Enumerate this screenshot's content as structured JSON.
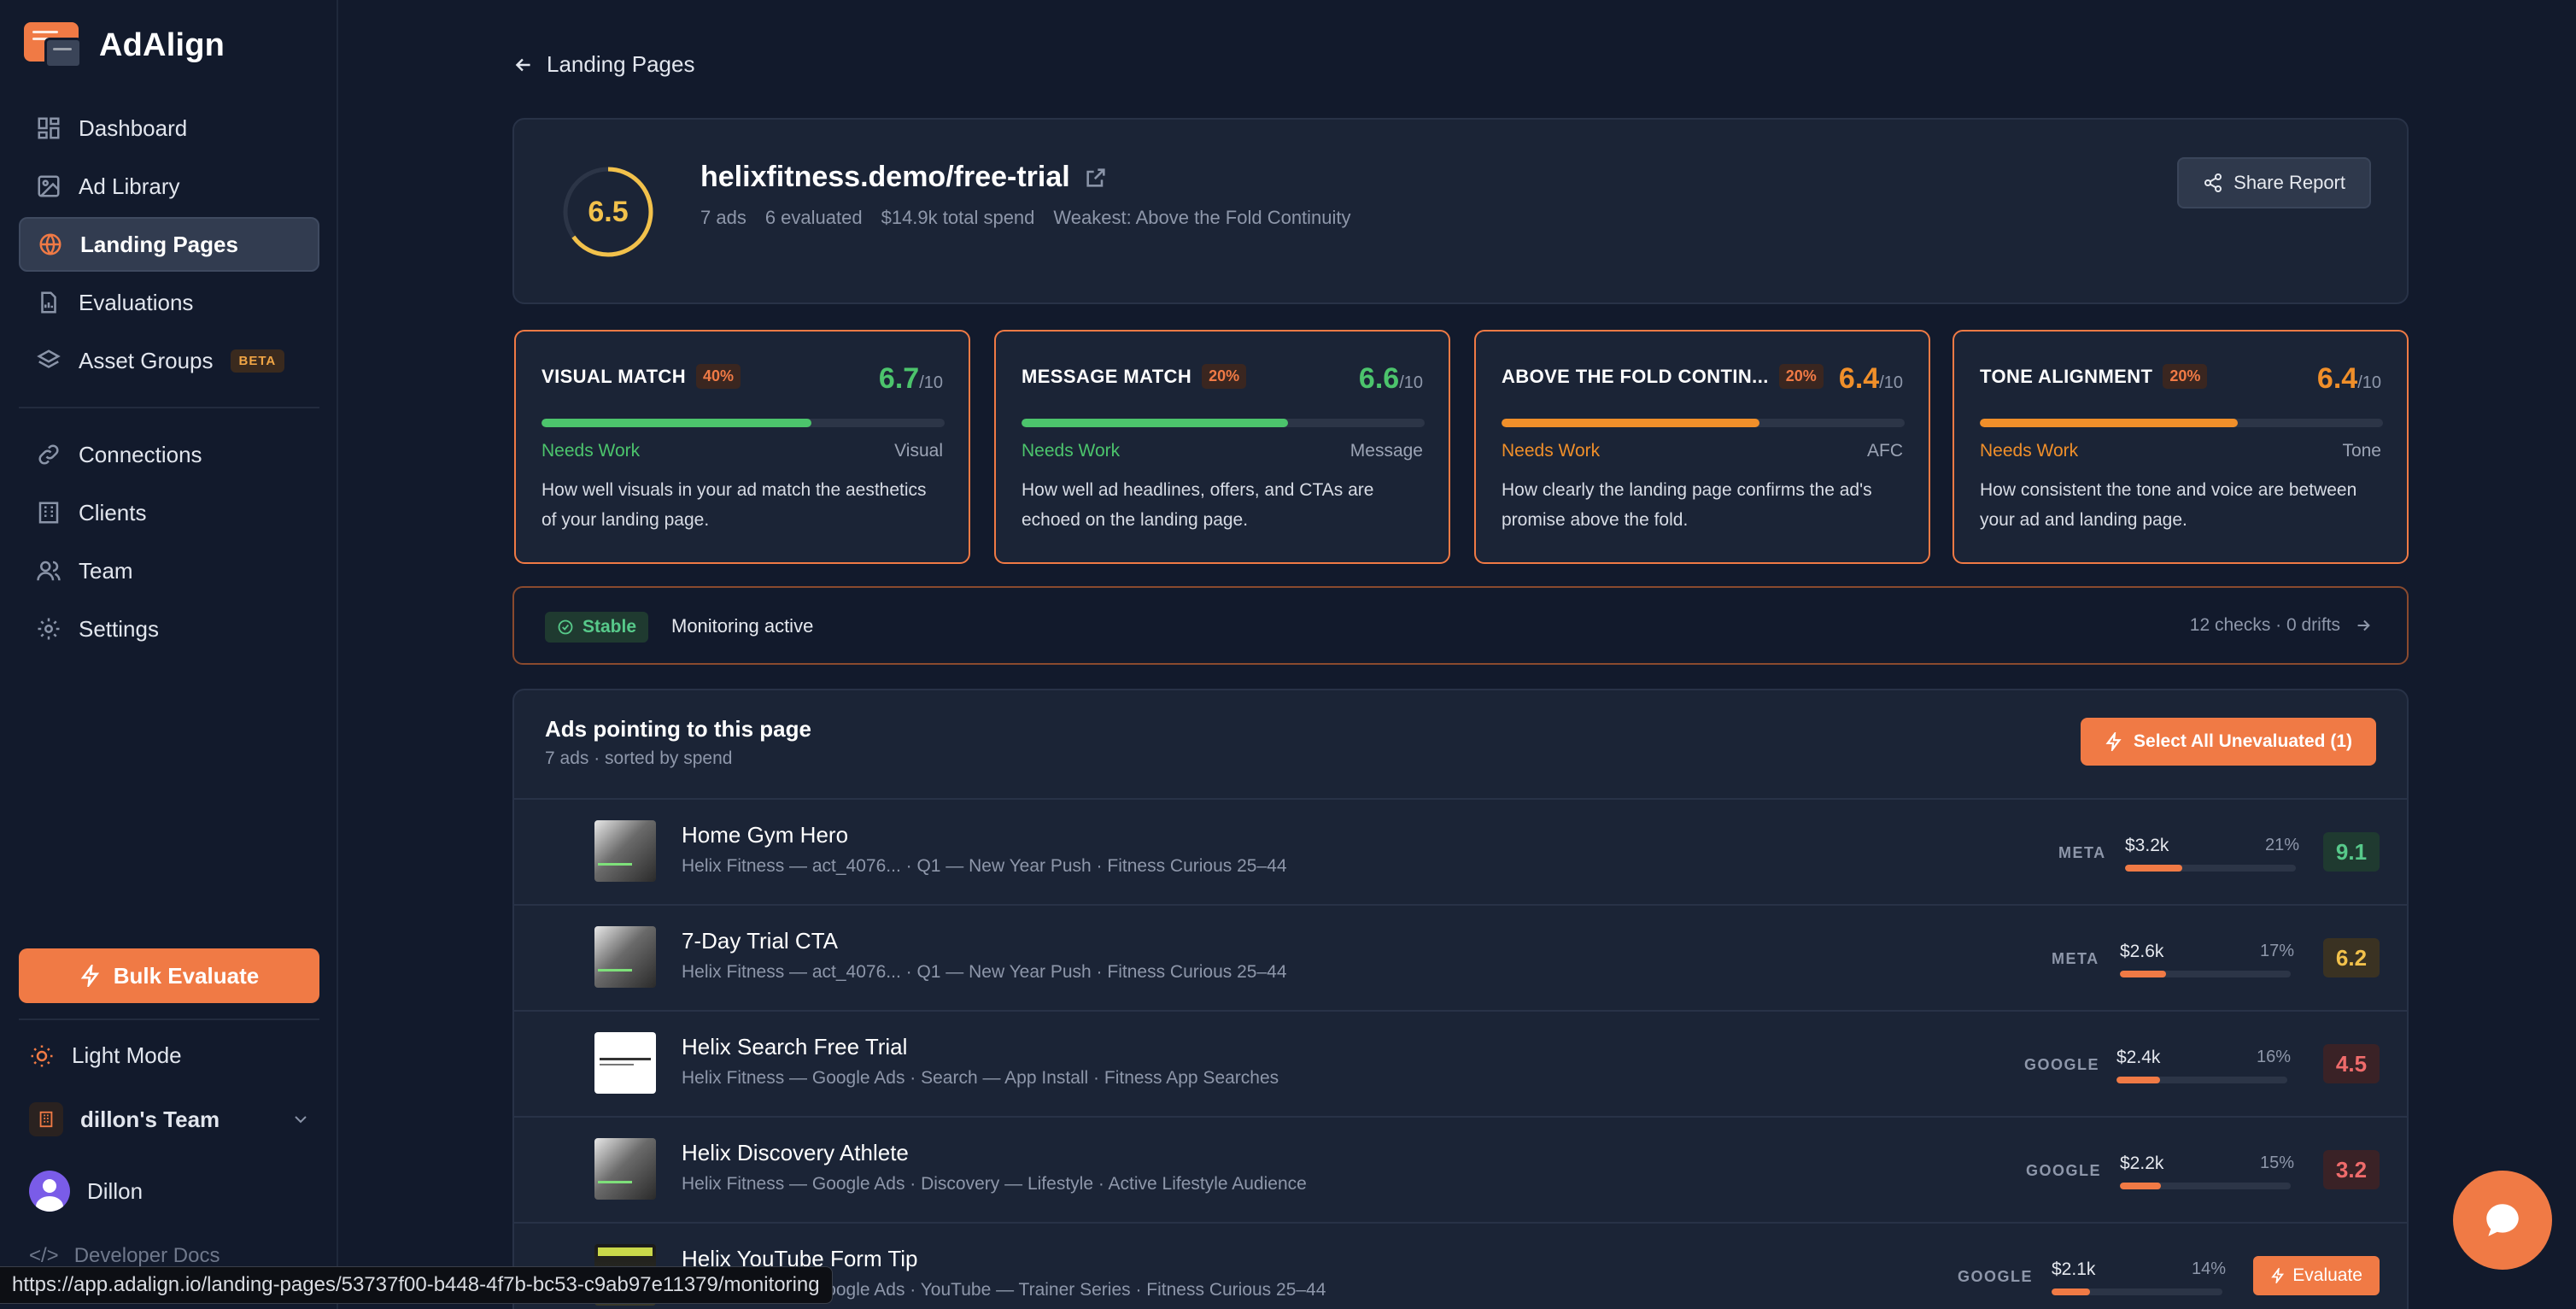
{
  "app": {
    "name": "AdAlign"
  },
  "sidebar": {
    "items": [
      {
        "label": "Dashboard",
        "icon": "grid-icon"
      },
      {
        "label": "Ad Library",
        "icon": "image-icon"
      },
      {
        "label": "Landing Pages",
        "icon": "globe-icon",
        "active": true
      },
      {
        "label": "Evaluations",
        "icon": "clipboard-icon"
      },
      {
        "label": "Asset Groups",
        "icon": "layers-icon",
        "badge": "BETA"
      },
      {
        "label": "Connections",
        "icon": "link-icon"
      },
      {
        "label": "Clients",
        "icon": "building-icon"
      },
      {
        "label": "Team",
        "icon": "users-icon"
      },
      {
        "label": "Settings",
        "icon": "gear-icon"
      }
    ],
    "bulk_evaluate": "Bulk Evaluate",
    "light_mode": "Light Mode",
    "team_name": "dillon's Team",
    "user_name": "Dillon",
    "developer_docs": "Developer Docs"
  },
  "breadcrumb": {
    "back_label": "Landing Pages"
  },
  "page": {
    "url": "helixfitness.demo/free-trial",
    "score": "6.5",
    "meta": [
      "7 ads",
      "6 evaluated",
      "$14.9k total spend",
      "Weakest: Above the Fold Continuity"
    ],
    "share_label": "Share Report"
  },
  "metrics": [
    {
      "name": "VISUAL MATCH",
      "weight": "40%",
      "score": "6.7",
      "out_of": "/10",
      "fill": 0.67,
      "status": "Needs Work",
      "tag": "Visual",
      "desc": "How well visuals in your ad match the aesthetics of your landing page.",
      "color": "#4cc46c"
    },
    {
      "name": "MESSAGE MATCH",
      "weight": "20%",
      "score": "6.6",
      "out_of": "/10",
      "fill": 0.66,
      "status": "Needs Work",
      "tag": "Message",
      "desc": "How well ad headlines, offers, and CTAs are echoed on the landing page.",
      "color": "#4cc46c"
    },
    {
      "name": "ABOVE THE FOLD CONTIN...",
      "weight": "20%",
      "score": "6.4",
      "out_of": "/10",
      "fill": 0.64,
      "status": "Needs Work",
      "tag": "AFC",
      "desc": "How clearly the landing page confirms the ad's promise above the fold.",
      "color": "#f08f2a"
    },
    {
      "name": "TONE ALIGNMENT",
      "weight": "20%",
      "score": "6.4",
      "out_of": "/10",
      "fill": 0.64,
      "status": "Needs Work",
      "tag": "Tone",
      "desc": "How consistent the tone and voice are between your ad and landing page.",
      "color": "#f08f2a"
    }
  ],
  "monitoring": {
    "badge": "Stable",
    "text": "Monitoring active",
    "summary": "12 checks · 0 drifts"
  },
  "ads_section": {
    "title": "Ads pointing to this page",
    "subtitle": "7 ads · sorted by spend",
    "select_label": "Select All Unevaluated (1)",
    "rows": [
      {
        "name": "Home Gym Hero",
        "sub": "Helix Fitness — act_4076... · Q1 — New Year Push · Fitness Curious 25–44",
        "platform": "META",
        "spend": "$3.2k",
        "pct": "21%",
        "share": 0.21,
        "score": "9.1",
        "score_color": "#57c98a",
        "score_bg": "#1f3a30",
        "thumb": "dark"
      },
      {
        "name": "7-Day Trial CTA",
        "sub": "Helix Fitness — act_4076... · Q1 — New Year Push · Fitness Curious 25–44",
        "platform": "META",
        "spend": "$2.6k",
        "pct": "17%",
        "share": 0.17,
        "score": "6.2",
        "score_color": "#f2c14b",
        "score_bg": "#3a3222",
        "thumb": "dark"
      },
      {
        "name": "Helix Search Free Trial",
        "sub": "Helix Fitness — Google Ads · Search — App Install · Fitness App Searches",
        "platform": "GOOGLE",
        "spend": "$2.4k",
        "pct": "16%",
        "share": 0.16,
        "score": "4.5",
        "score_color": "#ef6b6b",
        "score_bg": "#3a2226",
        "thumb": "light"
      },
      {
        "name": "Helix Discovery Athlete",
        "sub": "Helix Fitness — Google Ads · Discovery — Lifestyle · Active Lifestyle Audience",
        "platform": "GOOGLE",
        "spend": "$2.2k",
        "pct": "15%",
        "share": 0.15,
        "score": "3.2",
        "score_color": "#ef6b6b",
        "score_bg": "#3a2226",
        "thumb": "dark"
      },
      {
        "name": "Helix YouTube Form Tip",
        "sub": "Helix Fitness — Google Ads · YouTube — Trainer Series · Fitness Curious 25–44",
        "platform": "GOOGLE",
        "spend": "$2.1k",
        "pct": "14%",
        "share": 0.14,
        "score": "",
        "action": "Evaluate",
        "thumb": "video"
      }
    ]
  },
  "status_bar": {
    "url": "https://app.adalign.io/landing-pages/53737f00-b448-4f7b-bc53-c9ab97e11379/monitoring"
  }
}
